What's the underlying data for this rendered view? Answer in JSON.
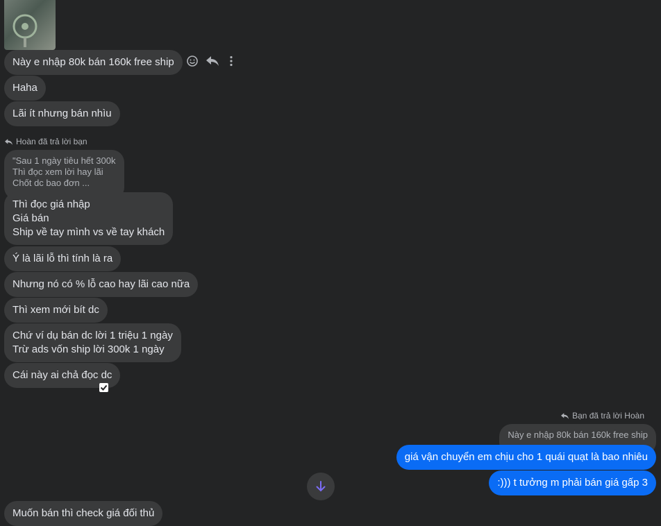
{
  "messages": {
    "m1": "Này e nhập 80k bán 160k free ship",
    "m2": "Haha",
    "m3": "Lãi ít nhưng bán nhìu",
    "reply_note_in": "Hoàn đã trả lời bạn",
    "quote_in": "\"Sau 1 ngày tiêu hết 300k\nThì đọc xem lời hay lãi\nChốt dc bao đơn ...",
    "m4": "Thì đọc giá nhập\nGiá bán\nShip về tay mình vs về tay khách",
    "m5": "Ý là lãi lỗ thì tính là ra",
    "m6": "Nhưng nó có % lỗ cao hay lãi cao nữa",
    "m7": "Thì xem mới bít dc",
    "m8": "Chứ ví dụ bán dc lời 1 triệu 1 ngày\nTrừ ads vốn ship lời 300k 1 ngày",
    "m9": "Cái này ai chả đọc dc",
    "reply_note_out": "Bạn đã trả lời Hoàn",
    "quote_out": "Này e nhập 80k bán 160k free ship",
    "o1": "giá vận chuyển em chịu cho 1 quái quạt là bao nhiêu",
    "o2": ":))) t tưởng m phải bán giá gấp 3",
    "m10": "Muốn bán thì check giá đối thủ"
  },
  "icons": {
    "react": "smiley-icon",
    "reply": "reply-icon",
    "more": "more-vertical-icon",
    "scroll": "arrow-down-icon",
    "seen": "checkbox-icon"
  },
  "colors": {
    "background": "#232425",
    "incoming_bubble": "#3a3b3c",
    "outgoing_bubble": "#0a6cf5",
    "scroll_arrow": "#7b6cf6"
  }
}
